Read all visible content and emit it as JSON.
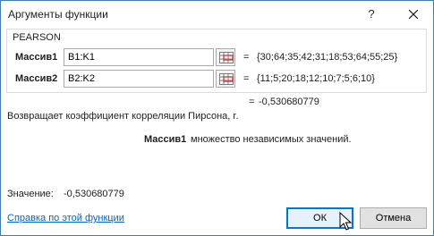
{
  "window": {
    "title": "Аргументы функции",
    "help_glyph": "?",
    "close_icon": "close-icon"
  },
  "function": {
    "name": "PEARSON",
    "args": [
      {
        "label": "Массив1",
        "value": "B1:K1",
        "equals": "=",
        "result": "{30;64;35;42;31;18;53;64;55;25}"
      },
      {
        "label": "Массив2",
        "value": "B2:K2",
        "equals": "=",
        "result": "{11;5;20;18;12;10;7;5;6;10}"
      }
    ],
    "result_equals": "=",
    "result": "-0,530680779",
    "description": "Возвращает коэффициент корреляции Пирсона, r.",
    "arg_description": {
      "name": "Массив1",
      "text": "множество независимых значений."
    }
  },
  "footer": {
    "value_label": "Значение:",
    "value": "-0,530680779",
    "help_link": "Справка по этой функции",
    "ok_label": "ОК",
    "cancel_label": "Отмена"
  },
  "colors": {
    "accent": "#0078d7",
    "link": "#0066cc",
    "border": "#3c7fb1"
  }
}
